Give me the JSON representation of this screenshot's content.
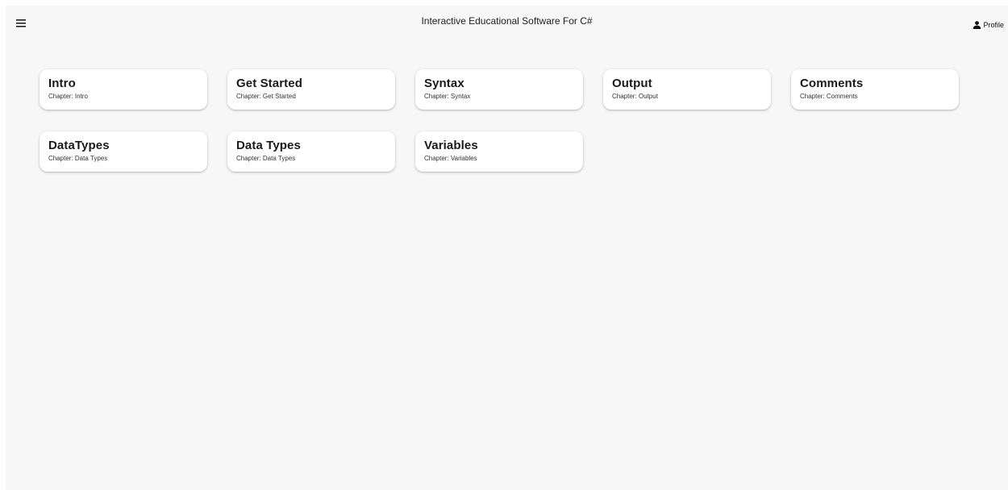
{
  "header": {
    "title": "Interactive Educational Software For C#",
    "profile_label": "Profile"
  },
  "chapters": [
    {
      "title": "Intro",
      "subtitle": "Chapter: Intro"
    },
    {
      "title": "Get Started",
      "subtitle": "Chapter: Get Started"
    },
    {
      "title": "Syntax",
      "subtitle": "Chapter: Syntax"
    },
    {
      "title": "Output",
      "subtitle": "Chapter: Output"
    },
    {
      "title": "Comments",
      "subtitle": "Chapter: Comments"
    },
    {
      "title": "DataTypes",
      "subtitle": "Chapter: Data Types"
    },
    {
      "title": "Data Types",
      "subtitle": "Chapter: Data Types"
    },
    {
      "title": "Variables",
      "subtitle": "Chapter: Variables"
    }
  ],
  "colors": {
    "background": "#f7f7f7",
    "card": "#ffffff",
    "text": "#1a1a1a"
  },
  "icons": {
    "menu": "hamburger-menu-icon",
    "profile": "person-icon"
  }
}
